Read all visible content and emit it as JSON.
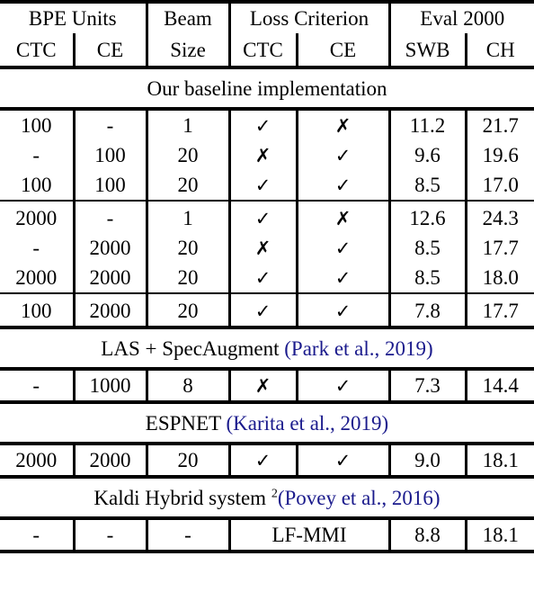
{
  "table": {
    "header": {
      "groups": [
        {
          "label": "BPE Units",
          "span": 2
        },
        {
          "label": "Beam",
          "span": 1
        },
        {
          "label": "Loss Criterion",
          "span": 2
        },
        {
          "label": "Eval 2000",
          "span": 2
        }
      ],
      "sub": [
        "CTC",
        "CE",
        "Size",
        "CTC",
        "CE",
        "SWB",
        "CH"
      ],
      "beam_line2": "Size"
    },
    "sections": [
      {
        "title": "Our baseline implementation",
        "title_cite": "",
        "title_footnote": "",
        "groups": [
          {
            "rows": [
              {
                "bpe_ctc": "100",
                "bpe_ce": "-",
                "beam": "1",
                "loss_ctc": "check",
                "loss_ce": "cross",
                "swb": "11.2",
                "ch": "21.7"
              },
              {
                "bpe_ctc": "-",
                "bpe_ce": "100",
                "beam": "20",
                "loss_ctc": "cross",
                "loss_ce": "check",
                "swb": "9.6",
                "ch": "19.6"
              },
              {
                "bpe_ctc": "100",
                "bpe_ce": "100",
                "beam": "20",
                "loss_ctc": "check",
                "loss_ce": "check",
                "swb": "8.5",
                "ch": "17.0"
              }
            ]
          },
          {
            "rows": [
              {
                "bpe_ctc": "2000",
                "bpe_ce": "-",
                "beam": "1",
                "loss_ctc": "check",
                "loss_ce": "cross",
                "swb": "12.6",
                "ch": "24.3"
              },
              {
                "bpe_ctc": "-",
                "bpe_ce": "2000",
                "beam": "20",
                "loss_ctc": "cross",
                "loss_ce": "check",
                "swb": "8.5",
                "ch": "17.7"
              },
              {
                "bpe_ctc": "2000",
                "bpe_ce": "2000",
                "beam": "20",
                "loss_ctc": "check",
                "loss_ce": "check",
                "swb": "8.5",
                "ch": "18.0"
              }
            ]
          },
          {
            "rows": [
              {
                "bpe_ctc": "100",
                "bpe_ce": "2000",
                "beam": "20",
                "loss_ctc": "check",
                "loss_ce": "check",
                "swb": "7.8",
                "ch": "17.7"
              }
            ]
          }
        ]
      },
      {
        "title": "LAS + SpecAugment ",
        "title_cite": "(Park et al., 2019)",
        "title_footnote": "",
        "groups": [
          {
            "rows": [
              {
                "bpe_ctc": "-",
                "bpe_ce": "1000",
                "beam": "8",
                "loss_ctc": "cross",
                "loss_ce": "check",
                "swb": "7.3",
                "ch": "14.4"
              }
            ]
          }
        ]
      },
      {
        "title": "ESPNET ",
        "title_cite": "(Karita et al., 2019)",
        "title_footnote": "",
        "groups": [
          {
            "rows": [
              {
                "bpe_ctc": "2000",
                "bpe_ce": "2000",
                "beam": "20",
                "loss_ctc": "check",
                "loss_ce": "check",
                "swb": "9.0",
                "ch": "18.1"
              }
            ]
          }
        ]
      },
      {
        "title": "Kaldi Hybrid system ",
        "title_cite": "(Povey et al., 2016)",
        "title_footnote": "2",
        "groups": [
          {
            "rows": [
              {
                "bpe_ctc": "-",
                "bpe_ce": "-",
                "beam": "-",
                "loss_span": "LF-MMI",
                "swb": "8.8",
                "ch": "18.1"
              }
            ]
          }
        ]
      }
    ],
    "marks": {
      "check": "✓",
      "cross": "✗"
    },
    "colors": {
      "text": "#000000",
      "citation": "#1a1a8c",
      "rule": "#000000"
    }
  }
}
